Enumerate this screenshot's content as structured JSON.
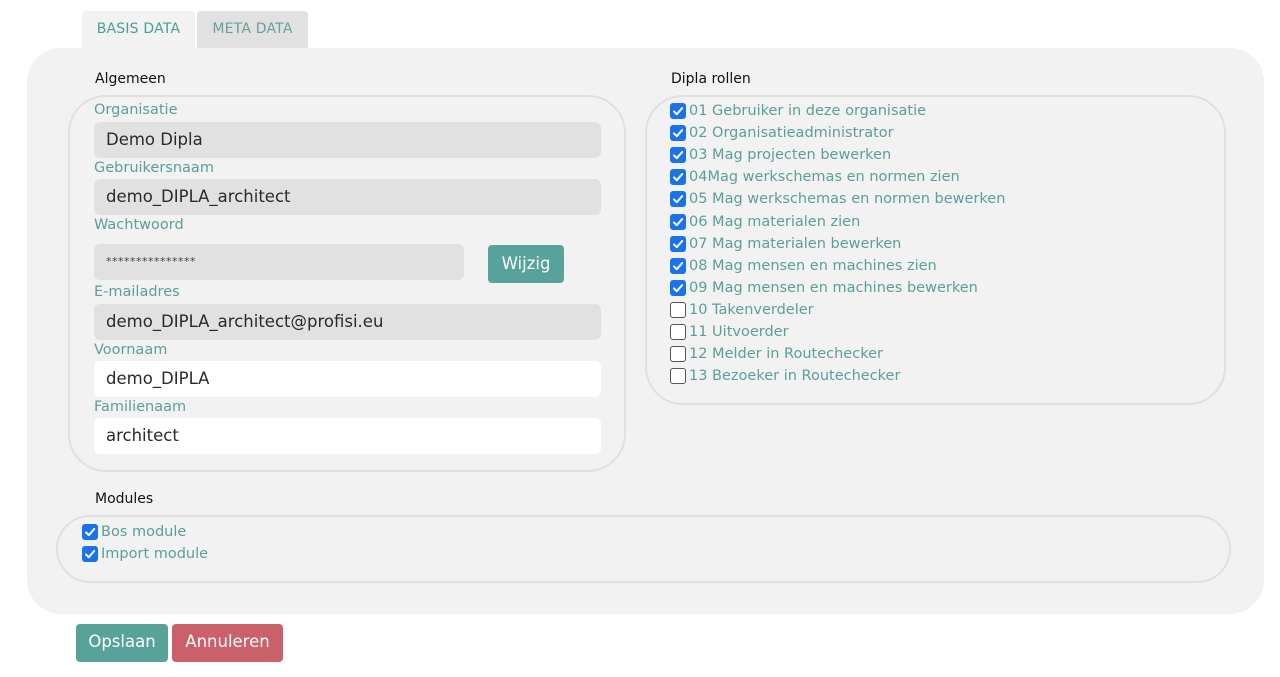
{
  "tabs": [
    {
      "label": "BASIS DATA"
    },
    {
      "label": "META DATA"
    }
  ],
  "general": {
    "title": "Algemeen",
    "organisation_label": "Organisatie",
    "organisation_value": "Demo Dipla",
    "username_label": "Gebruikersnaam",
    "username_value": "demo_DIPLA_architect",
    "password_label": "Wachtwoord",
    "password_value": "***************",
    "change_button": "Wijzig",
    "email_label": "E-mailadres",
    "email_value": "demo_DIPLA_architect@profisi.eu",
    "firstname_label": "Voornaam",
    "firstname_value": "demo_DIPLA",
    "lastname_label": "Familienaam",
    "lastname_value": "architect"
  },
  "roles": {
    "title": "Dipla rollen",
    "items": [
      {
        "label": "01 Gebruiker in deze organisatie",
        "checked": true
      },
      {
        "label": "02 Organisatieadministrator",
        "checked": true
      },
      {
        "label": "03 Mag projecten bewerken",
        "checked": true
      },
      {
        "label": "04Mag werkschemas en normen zien",
        "checked": true
      },
      {
        "label": "05 Mag werkschemas en normen bewerken",
        "checked": true
      },
      {
        "label": "06 Mag materialen zien",
        "checked": true
      },
      {
        "label": "07 Mag materialen bewerken",
        "checked": true
      },
      {
        "label": "08 Mag mensen en machines zien",
        "checked": true
      },
      {
        "label": "09 Mag mensen en machines bewerken",
        "checked": true
      },
      {
        "label": "10 Takenverdeler",
        "checked": false
      },
      {
        "label": "11 Uitvoerder",
        "checked": false
      },
      {
        "label": "12 Melder in Routechecker",
        "checked": false
      },
      {
        "label": "13 Bezoeker in Routechecker",
        "checked": false
      }
    ]
  },
  "modules": {
    "title": "Modules",
    "items": [
      {
        "label": "Bos module",
        "checked": true
      },
      {
        "label": "Import module",
        "checked": true
      }
    ]
  },
  "actions": {
    "save_label": "Opslaan",
    "cancel_label": "Annuleren"
  },
  "colors": {
    "accent": "#57a39a",
    "danger": "#c9606a",
    "checkbox": "#1a73e8",
    "label": "#5a9f99"
  }
}
